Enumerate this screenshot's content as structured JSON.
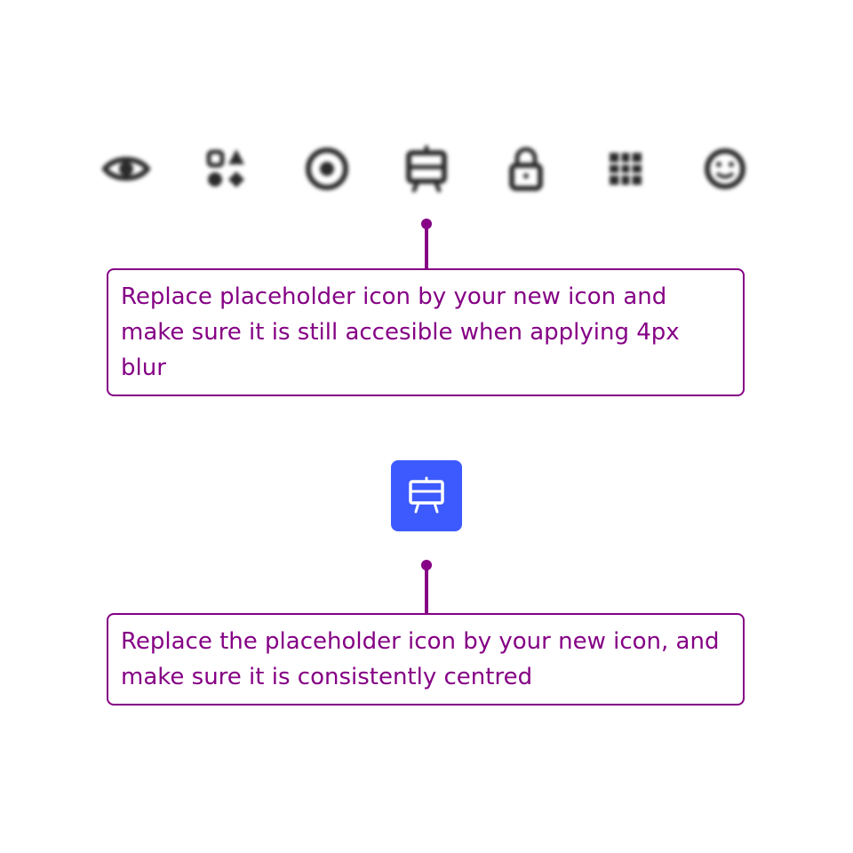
{
  "icon_row": {
    "icons": [
      "eye-icon",
      "shapes-icon",
      "radio-button-icon",
      "easel-icon",
      "lock-icon",
      "grid-icon",
      "smiley-icon"
    ],
    "blur_color": "#2b2b2b"
  },
  "notes": {
    "blur": "Replace placeholder icon by your new icon and make sure it is still accesible when applying 4px blur",
    "centred": "Replace the placeholder icon by your new icon, and make sure it is consistently centred"
  },
  "preview": {
    "icon": "easel-icon",
    "tile_color": "#3d5afe",
    "icon_color": "#ffffff"
  },
  "colors": {
    "annotation": "#850085"
  }
}
